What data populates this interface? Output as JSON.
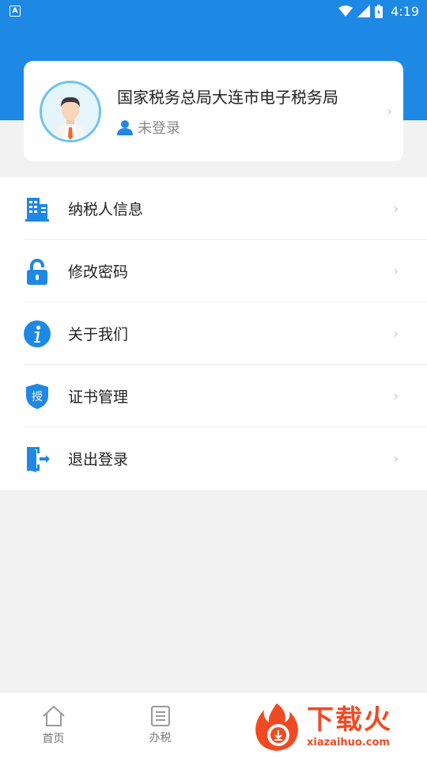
{
  "status_bar": {
    "time": "4:19"
  },
  "profile": {
    "title": "国家税务总局大连市电子税务局",
    "login_status": "未登录"
  },
  "menu": [
    {
      "label": "纳税人信息",
      "icon": "building-icon"
    },
    {
      "label": "修改密码",
      "icon": "lock-icon"
    },
    {
      "label": "关于我们",
      "icon": "info-icon"
    },
    {
      "label": "证书管理",
      "icon": "certificate-shield-icon",
      "icon_text": "授"
    },
    {
      "label": "退出登录",
      "icon": "logout-door-icon"
    }
  ],
  "bottom_nav": [
    {
      "label": "首页",
      "icon": "home-icon"
    },
    {
      "label": "办税",
      "icon": "list-icon"
    }
  ],
  "watermark": {
    "big": "下载火",
    "small": "xiazaihuo.com"
  },
  "colors": {
    "primary": "#1e88e5",
    "background": "#f2f2f2",
    "watermark": "#f04a23"
  }
}
